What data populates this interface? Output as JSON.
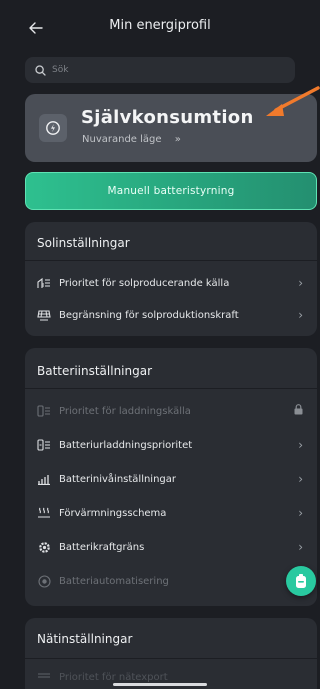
{
  "header": {
    "title": "Min energiprofil",
    "back_icon": "arrow-left-icon"
  },
  "search": {
    "placeholder": "Sök",
    "icon": "search-icon"
  },
  "mode_card": {
    "title": "Självkonsumtion",
    "subtitle": "Nuvarande läge",
    "chevron": "»"
  },
  "manual_button": {
    "label": "Manuell batteristyrning"
  },
  "solar_section": {
    "title": "Solinställningar",
    "items": [
      {
        "label": "Prioritet för solproducerande källa",
        "icon": "solar-priority-icon"
      },
      {
        "label": "Begränsning för solproduktionskraft",
        "icon": "solar-panel-limit-icon"
      }
    ]
  },
  "battery_section": {
    "title": "Batteriinställningar",
    "items": [
      {
        "label": "Prioritet för laddningskälla",
        "icon": "charge-source-icon",
        "locked": true
      },
      {
        "label": "Batteriurladdningsprioritet",
        "icon": "discharge-priority-icon"
      },
      {
        "label": "Batterinivåinställningar",
        "icon": "battery-level-icon"
      },
      {
        "label": "Förvärmningsschema",
        "icon": "preheat-icon"
      },
      {
        "label": "Batterikraftgräns",
        "icon": "gear-icon"
      },
      {
        "label": "Batteriautomatisering",
        "icon": "automation-icon",
        "disabled": true
      }
    ]
  },
  "grid_section": {
    "title": "Nätinställningar",
    "items": [
      {
        "label": "Prioritet för nätexport",
        "icon": "grid-export-icon"
      }
    ]
  },
  "colors": {
    "accent": "#2ec08f",
    "card": "#2a2d33",
    "mode_card": "#4a4e56",
    "annotation": "#f07a2c"
  }
}
